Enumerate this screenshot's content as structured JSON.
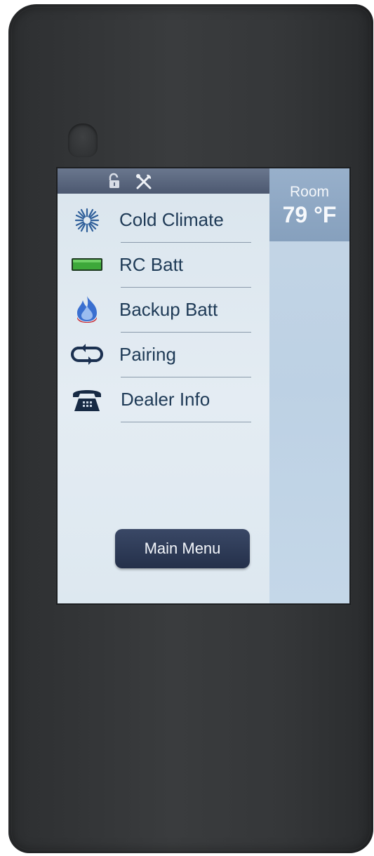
{
  "menu": {
    "items": [
      {
        "label": "Cold Climate",
        "icon": "snowflake-icon"
      },
      {
        "label": "RC Batt",
        "icon": "battery-icon"
      },
      {
        "label": "Backup Batt",
        "icon": "flame-icon"
      },
      {
        "label": "Pairing",
        "icon": "pairing-arrows-icon"
      },
      {
        "label": "Dealer Info",
        "icon": "telephone-icon"
      }
    ],
    "main_menu_label": "Main Menu"
  },
  "status": {
    "icons": [
      "unlock-icon",
      "tools-icon"
    ]
  },
  "room": {
    "label": "Room",
    "temperature": "79 °F"
  },
  "colors": {
    "menu_text": "#1e3a56",
    "status_bar": "#4c5870",
    "button": "#24304a",
    "room_box": "#86a0bd",
    "battery_fill": "#3da83a",
    "flame": "#3a6fd0",
    "flame_base": "#c8202a"
  }
}
